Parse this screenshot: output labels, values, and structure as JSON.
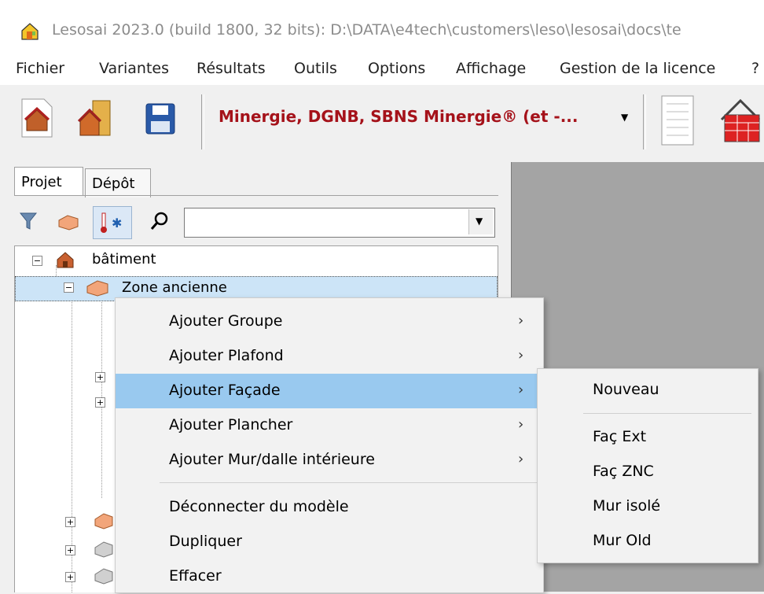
{
  "window": {
    "title": "Lesosai 2023.0 (build 1800, 32 bits): D:\\DATA\\e4tech\\customers\\leso\\lesosai\\docs\\te"
  },
  "menubar": [
    "Fichier",
    "Variantes",
    "Résultats",
    "Outils",
    "Options",
    "Affichage",
    "Gestion de la licence",
    "?"
  ],
  "toolbar": {
    "label_select": "Minergie, DGNB, SBNS Minergie® (et -..."
  },
  "tabs": [
    "Projet",
    "Dépôt"
  ],
  "tree": {
    "root": "bâtiment",
    "zone": "Zone ancienne"
  },
  "context_menu": {
    "items": [
      "Ajouter Groupe",
      "Ajouter Plafond",
      "Ajouter Façade",
      "Ajouter Plancher",
      "Ajouter Mur/dalle intérieure",
      "Déconnecter du modèle",
      "Dupliquer",
      "Effacer"
    ],
    "submenu_arrow": "›"
  },
  "submenu": {
    "items": [
      "Nouveau",
      "Faç Ext",
      "Faç ZNC",
      "Mur isolé",
      "Mur Old"
    ]
  },
  "colors": {
    "highlight": "#99c9ef",
    "label_red": "#a5121a",
    "workspace": "#a4a4a4"
  }
}
